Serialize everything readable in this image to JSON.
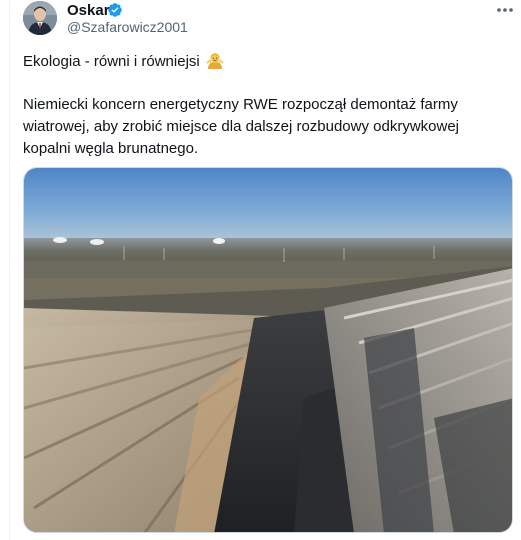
{
  "author": {
    "display_name": "Oskar",
    "handle": "@Szafarowicz2001",
    "verified_icon": "verified-badge-icon",
    "verified_color": "#1d9bf0"
  },
  "menu_icon": "more-horizontal-icon",
  "tweet": {
    "line1": "Ekologia - równi i równiejsi",
    "line1_emoji": "person-shrugging-emoji",
    "body_lines": [
      "Niemiecki koncern energetyczny RWE rozpoczął demontaż farmy",
      "wiatrowej, aby zrobić miejsce dla dalszej rozbudowy odkrywkowej",
      "kopalni węgla brunatnego."
    ]
  },
  "media": {
    "kind": "photo",
    "subject": "aerial-open-pit-lignite-mine"
  }
}
